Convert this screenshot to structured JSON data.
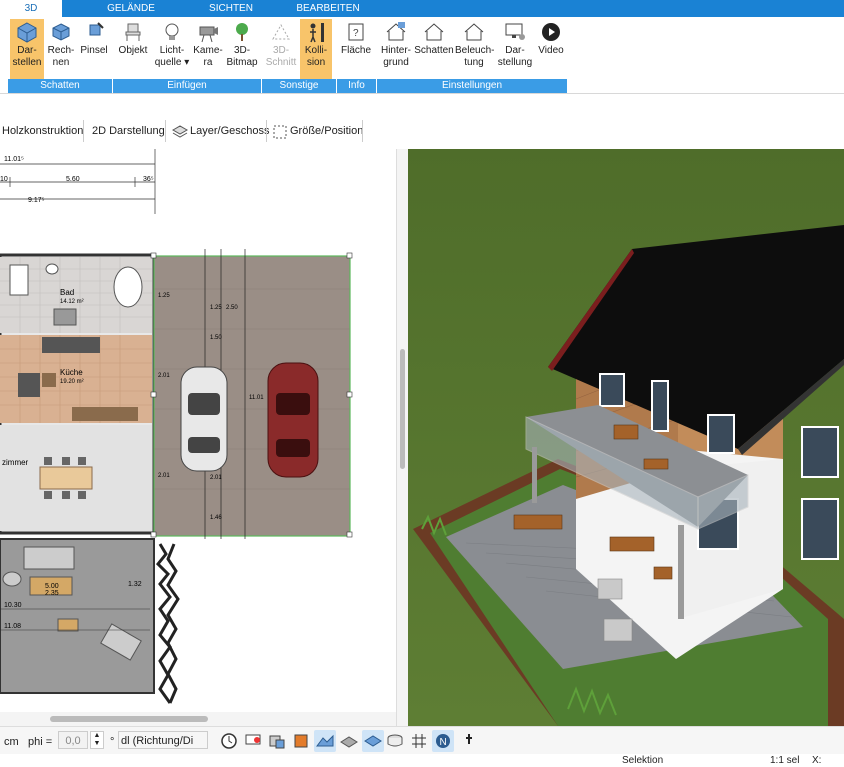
{
  "tabs": [
    "3D",
    "GELÄNDE",
    "SICHTEN",
    "BEARBEITEN"
  ],
  "ribbon": {
    "buttons": [
      {
        "label1": "Dar-",
        "label2": "stellen",
        "icon": "cube-icon"
      },
      {
        "label1": "Rech-",
        "label2": "nen",
        "icon": "cube-icon"
      },
      {
        "label1": "Pinsel",
        "label2": "",
        "icon": "brush-icon"
      },
      {
        "label1": "Objekt",
        "label2": "",
        "icon": "chair-icon"
      },
      {
        "label1": "Licht-",
        "label2": "quelle ▾",
        "icon": "lightbulb-icon"
      },
      {
        "label1": "Kame-",
        "label2": "ra",
        "icon": "camera-icon"
      },
      {
        "label1": "3D-",
        "label2": "Bitmap",
        "icon": "tree-icon"
      },
      {
        "label1": "3D-",
        "label2": "Schnitt",
        "icon": "section-icon"
      },
      {
        "label1": "Kolli-",
        "label2": "sion",
        "icon": "person-icon"
      },
      {
        "label1": "Fläche",
        "label2": "",
        "icon": "area-icon"
      },
      {
        "label1": "Hinter-",
        "label2": "grund",
        "icon": "house-icon"
      },
      {
        "label1": "Schatten",
        "label2": "",
        "icon": "house-icon"
      },
      {
        "label1": "Beleuch-",
        "label2": "tung",
        "icon": "house-icon"
      },
      {
        "label1": "Dar-",
        "label2": "stellung",
        "icon": "monitor-icon"
      },
      {
        "label1": "Video",
        "label2": "",
        "icon": "play-icon"
      }
    ],
    "groups": [
      "Schatten",
      "Einfügen",
      "Sonstige",
      "Info",
      "Einstellungen"
    ]
  },
  "toolbar2": [
    "Holzkonstruktion",
    "2D Darstellung",
    "Layer/Geschoss",
    "Größe/Position"
  ],
  "plan": {
    "dims": [
      "11.01⁵",
      "5.60",
      "36⁵",
      "9.17⁵",
      "10",
      "1.25",
      "1.25",
      "1.50",
      "2.01",
      "2.01",
      "2.01",
      "1.94",
      "1.46",
      "1.32",
      "2.50",
      "11.01",
      "1.32",
      "5.00",
      "2.35",
      "10.30",
      "11.08",
      "31.85"
    ],
    "rooms": [
      {
        "name": "Bad",
        "area": "14.12 m²"
      },
      {
        "name": "Küche",
        "area": "19.20 m²"
      },
      {
        "name": "zimmer",
        "area": ""
      }
    ]
  },
  "bottombar": {
    "unit": "cm",
    "phi_label": "phi =",
    "phi_value": "0,0",
    "degree": "°",
    "dropdown": "dl (Richtung/Di"
  },
  "status": {
    "mode": "Selektion",
    "scale": "1:1 sel",
    "x": "X:"
  },
  "colors": {
    "ribbon": "#1a82d4",
    "active": "#f8c46a",
    "roof": "#111111",
    "grass": "#4d6b2a"
  }
}
